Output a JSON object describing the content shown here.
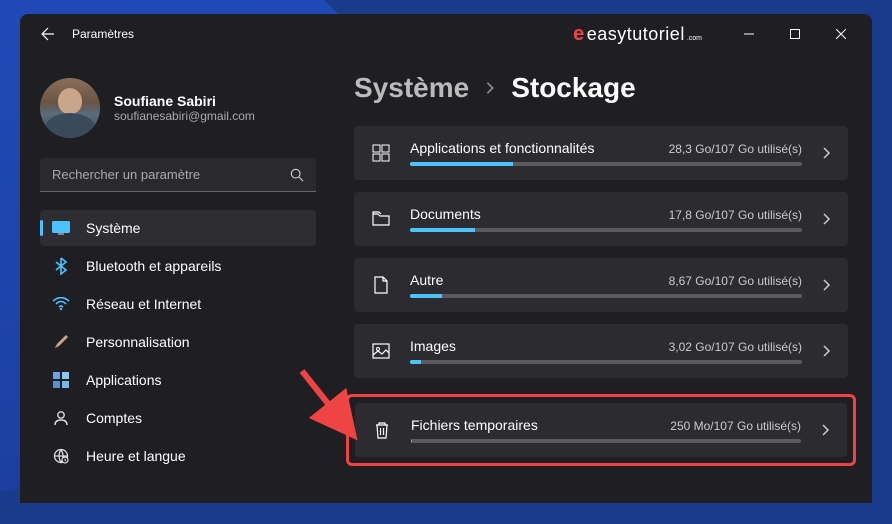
{
  "window": {
    "title": "Paramètres"
  },
  "logo": {
    "prefix": "e",
    "text": "easytutoriel",
    "suffix": ".com"
  },
  "profile": {
    "name": "Soufiane Sabiri",
    "email": "soufianesabiri@gmail.com"
  },
  "search": {
    "placeholder": "Rechercher un paramètre"
  },
  "sidebar": {
    "items": [
      {
        "label": "Système",
        "icon": "display",
        "active": true
      },
      {
        "label": "Bluetooth et appareils",
        "icon": "bluetooth",
        "active": false
      },
      {
        "label": "Réseau et Internet",
        "icon": "wifi",
        "active": false
      },
      {
        "label": "Personnalisation",
        "icon": "brush",
        "active": false
      },
      {
        "label": "Applications",
        "icon": "apps",
        "active": false
      },
      {
        "label": "Comptes",
        "icon": "user",
        "active": false
      },
      {
        "label": "Heure et langue",
        "icon": "globe",
        "active": false
      }
    ]
  },
  "breadcrumb": {
    "parent": "Système",
    "current": "Stockage"
  },
  "storage": [
    {
      "label": "Applications et fonctionnalités",
      "usage": "28,3 Go/107 Go utilisé(s)",
      "percent": 26.4,
      "icon": "grid",
      "highlight": false
    },
    {
      "label": "Documents",
      "usage": "17,8 Go/107 Go utilisé(s)",
      "percent": 16.6,
      "icon": "folder",
      "highlight": false
    },
    {
      "label": "Autre",
      "usage": "8,67 Go/107 Go utilisé(s)",
      "percent": 8.1,
      "icon": "file",
      "highlight": false
    },
    {
      "label": "Images",
      "usage": "3,02 Go/107 Go utilisé(s)",
      "percent": 2.8,
      "icon": "image",
      "highlight": false
    },
    {
      "label": "Fichiers temporaires",
      "usage": "250 Mo/107 Go utilisé(s)",
      "percent": 0.3,
      "icon": "trash",
      "highlight": true
    }
  ],
  "colors": {
    "accent": "#4cc2ff",
    "highlight": "#ef4444"
  }
}
